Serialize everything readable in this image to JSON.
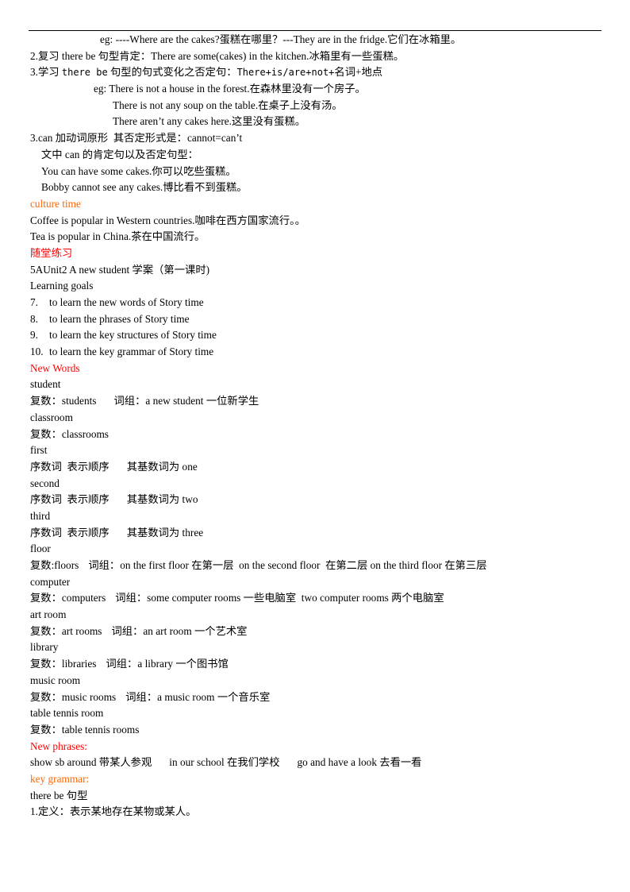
{
  "document": {
    "lines": {
      "l01": "eg: ----Where are the cakes?蛋糕在哪里？---They are in the fridge.它们在冰箱里。",
      "l02": "2.复习 there be 句型肯定：There are some(cakes) in the kitchen.冰箱里有一些蛋糕。",
      "l03a": "3.学习 ",
      "l03b": "there be",
      "l03c": " 句型的句式变化之否定句：",
      "l03d": "There+is/are+not+",
      "l03e": "名词+地点",
      "l04": "eg: There is not a house in the forest.在森林里没有一个房子。",
      "l05": "There is not any soup on the table.在桌子上没有汤。",
      "l06": "There aren’t any cakes here.这里没有蛋糕。",
      "l07": "3.can 加动词原形  其否定形式是：cannot=can’t",
      "l08": "文中 can 的肯定句以及否定句型：",
      "l09": "You can have some cakes.你可以吃些蛋糕。",
      "l10": "Bobby cannot see any cakes.博比看不到蛋糕。",
      "l11": "culture time",
      "l12": "Coffee is popular in Western countries.咖啡在西方国家流行。。",
      "l13": "Tea is popular in China.茶在中国流行。",
      "l14": "随堂练习",
      "l15": "5AUnit2 A new student 学案（第一课时)",
      "l16": "Learning goals"
    },
    "goals": [
      {
        "num": "7.",
        "text": "to learn the new words of Story time"
      },
      {
        "num": "8.",
        "text": "to learn the phrases of Story time"
      },
      {
        "num": "9.",
        "text": "to learn the key structures of Story time"
      },
      {
        "num": "10.",
        "text": "to learn the key grammar of Story time"
      }
    ],
    "new_words_heading": "New Words",
    "words": {
      "w01": "student",
      "w02a": "复数：students",
      "w02b": "词组：a new student 一位新学生",
      "w03": "classroom",
      "w04": "复数：classrooms",
      "w05": "first",
      "w06a": "序数词  表示顺序",
      "w06b": "其基数词为 one",
      "w07": "second",
      "w08a": "序数词  表示顺序",
      "w08b": "其基数词为 two",
      "w09": "third",
      "w10a": "序数词  表示顺序",
      "w10b": "其基数词为 three",
      "w11": "floor",
      "w12a": "复数:floors",
      "w12b": "词组：on the first floor 在第一层  on the second floor  在第二层 on the third floor 在第三层",
      "w13": "computer",
      "w14a": "复数：computers",
      "w14b": "词组：some computer rooms 一些电脑室  two computer rooms 两个电脑室",
      "w15": "art room",
      "w16a": "复数：art rooms",
      "w16b": "词组：an art room 一个艺术室",
      "w17": "library",
      "w18a": "复数：libraries",
      "w18b": "词组：a library 一个图书馆",
      "w19": "music room",
      "w20a": "复数：music rooms",
      "w20b": "词组：a music room 一个音乐室",
      "w21": "table tennis room",
      "w22": "复数：table tennis rooms"
    },
    "new_phrases_heading": "New phrases:",
    "phrases": {
      "p1": "show sb around 带某人参观",
      "p2": "in our school 在我们学校",
      "p3": "go and have a look 去看一看"
    },
    "key_grammar_heading": "key grammar:",
    "grammar": {
      "g1": "there be 句型",
      "g2": "1.定义：表示某地存在某物或某人。"
    },
    "colors": {
      "orange_heading": "#ff6600",
      "red_heading": "#ff0000",
      "text": "#000000"
    }
  }
}
